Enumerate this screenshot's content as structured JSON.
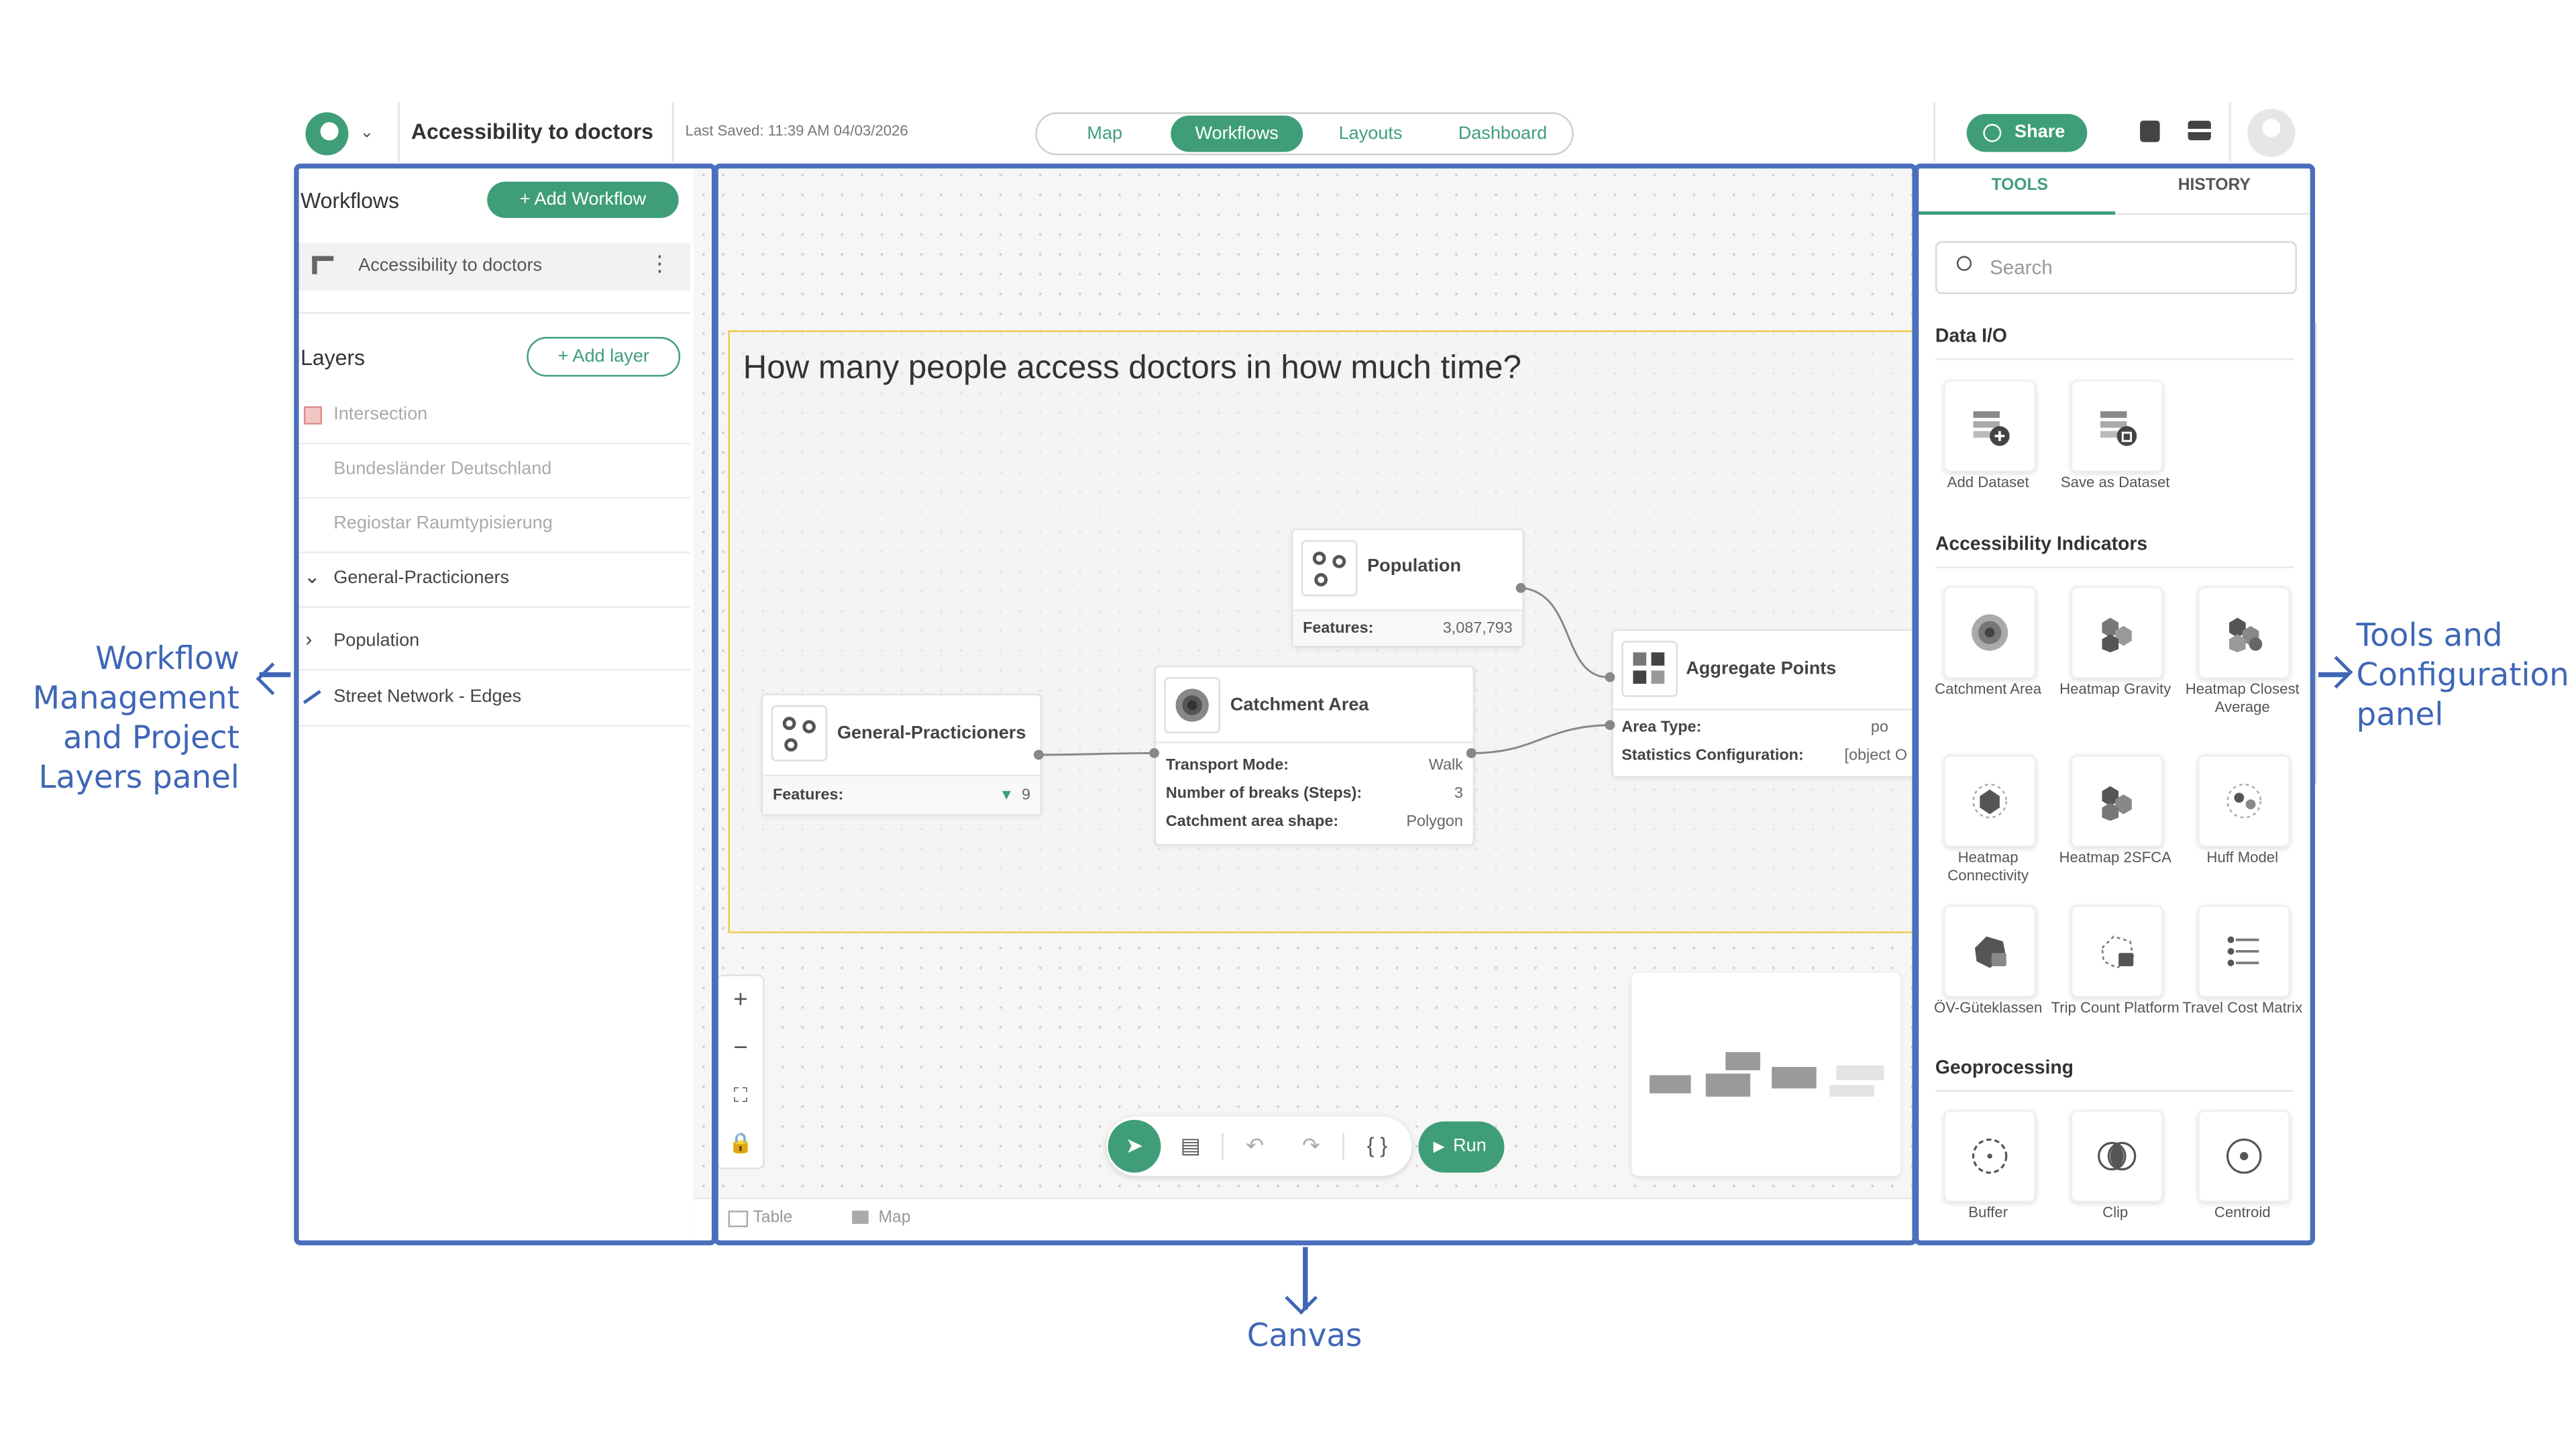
{
  "header": {
    "title": "Accessibility to doctors",
    "last_saved": "Last Saved: 11:39 AM 04/03/2026",
    "tabs": [
      {
        "label": "Map",
        "active": false
      },
      {
        "label": "Workflows",
        "active": true
      },
      {
        "label": "Layouts",
        "active": false
      },
      {
        "label": "Dashboard",
        "active": false
      }
    ],
    "share_label": "Share"
  },
  "left_panel": {
    "workflows_title": "Workflows",
    "add_workflow_label": "+ Add Workflow",
    "workflow_item": "Accessibility to doctors",
    "layers_title": "Layers",
    "add_layer_label": "+ Add layer",
    "layers": [
      {
        "label": "Intersection",
        "muted": true
      },
      {
        "label": "Bundesländer Deutschland",
        "muted": true
      },
      {
        "label": "Regiostar Raumtypisierung",
        "muted": true
      },
      {
        "label": "General-Practicioners",
        "muted": false
      },
      {
        "label": "Population",
        "muted": false
      },
      {
        "label": "Street Network - Edges",
        "muted": false
      }
    ]
  },
  "canvas": {
    "group_title": "How many people access doctors in how much time?",
    "nodes": {
      "population": {
        "title": "Population",
        "features_label": "Features:",
        "features_value": "3,087,793"
      },
      "gp": {
        "title": "General-Practicioners",
        "features_label": "Features:",
        "features_value": "9"
      },
      "catchment": {
        "title": "Catchment Area",
        "props": [
          {
            "k": "Transport Mode:",
            "v": "Walk"
          },
          {
            "k": "Number of breaks (Steps):",
            "v": "3"
          },
          {
            "k": "Catchment area shape:",
            "v": "Polygon"
          }
        ]
      },
      "aggregate": {
        "title": "Aggregate Points",
        "props": [
          {
            "k": "Area Type:",
            "v": "po"
          },
          {
            "k": "Statistics Configuration:",
            "v": "[object O"
          }
        ]
      }
    },
    "run_label": "Run",
    "bottom_tabs": [
      "Table",
      "Map"
    ]
  },
  "right_panel": {
    "tabs": [
      {
        "label": "TOOLS",
        "active": true
      },
      {
        "label": "HISTORY",
        "active": false
      }
    ],
    "search_placeholder": "Search",
    "categories": [
      {
        "title": "Data I/O",
        "tools": [
          {
            "label": "Add Dataset"
          },
          {
            "label": "Save as Dataset"
          }
        ]
      },
      {
        "title": "Accessibility Indicators",
        "tools": [
          {
            "label": "Catchment Area"
          },
          {
            "label": "Heatmap Gravity"
          },
          {
            "label": "Heatmap Closest Average"
          },
          {
            "label": "Heatmap Connectivity"
          },
          {
            "label": "Heatmap 2SFCA"
          },
          {
            "label": "Huff Model"
          },
          {
            "label": "ÖV-Güteklassen"
          },
          {
            "label": "Trip Count Platform"
          },
          {
            "label": "Travel Cost Matrix"
          }
        ]
      },
      {
        "title": "Geoprocessing",
        "tools": [
          {
            "label": "Buffer"
          },
          {
            "label": "Clip"
          },
          {
            "label": "Centroid"
          }
        ]
      }
    ]
  },
  "callouts": {
    "left": "Workflow Management and Project Layers panel",
    "bottom": "Canvas",
    "right": "Tools and Configuration panel"
  },
  "colors": {
    "brand": "#3f9e78",
    "callout": "#3f66b6",
    "group_border": "#f2c94c"
  }
}
